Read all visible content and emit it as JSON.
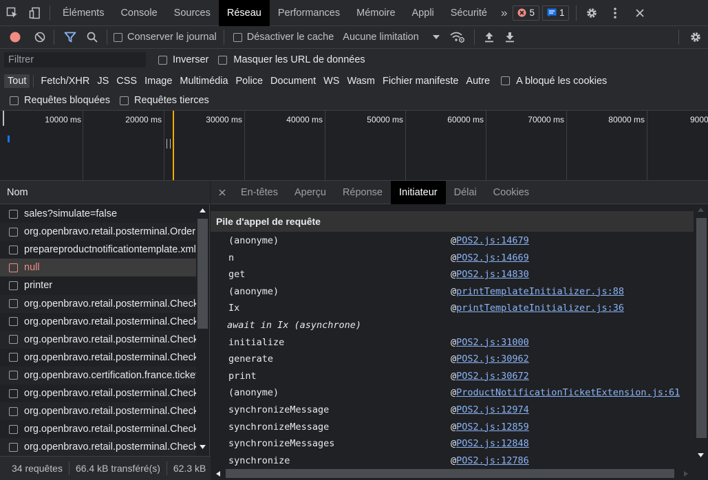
{
  "tabs": {
    "items": [
      "Éléments",
      "Console",
      "Sources",
      "Réseau",
      "Performances",
      "Mémoire",
      "Appli",
      "Sécurité"
    ],
    "more": "»",
    "errors": "5",
    "messages": "1"
  },
  "toolbar": {
    "preserve_log": "Conserver le journal",
    "disable_cache": "Désactiver le cache",
    "throttling": "Aucune limitation"
  },
  "filters": {
    "placeholder": "Filtrer",
    "invert": "Inverser",
    "hide_data_urls": "Masquer les URL de données",
    "types": [
      "Tout",
      "Fetch/XHR",
      "JS",
      "CSS",
      "Image",
      "Multimédia",
      "Police",
      "Document",
      "WS",
      "Wasm",
      "Fichier manifeste",
      "Autre"
    ],
    "blocked_cookies": "A bloqué les cookies",
    "blocked_requests": "Requêtes bloquées",
    "third_party": "Requêtes tierces"
  },
  "overview": {
    "ticks": [
      "10000 ms",
      "20000 ms",
      "30000 ms",
      "40000 ms",
      "50000 ms",
      "60000 ms",
      "70000 ms",
      "80000 ms",
      "9000"
    ]
  },
  "requests": {
    "header": "Nom",
    "items": [
      "sales?simulate=false",
      "org.openbravo.retail.posterminal.OrderLoader",
      "prepareproductnotificationtemplate.xml",
      "null",
      "printer",
      "org.openbravo.retail.posterminal.CheckBusinessPartnerCredit",
      "org.openbravo.retail.posterminal.CheckBusinessPartnerCredit",
      "org.openbravo.retail.posterminal.CheckBusinessPartnerCredit",
      "org.openbravo.retail.posterminal.CheckBusinessPartnerCredit",
      "org.openbravo.certification.france.ticket",
      "org.openbravo.retail.posterminal.CheckBusinessPartnerCredit",
      "org.openbravo.retail.posterminal.CheckBusinessPartnerCredit",
      "org.openbravo.retail.posterminal.CheckBusinessPartnerCredit",
      "org.openbravo.retail.posterminal.CheckBusinessPartnerCredit"
    ],
    "selected_index": 3
  },
  "detail": {
    "tabs": [
      "En-têtes",
      "Aperçu",
      "Réponse",
      "Initiateur",
      "Délai",
      "Cookies"
    ],
    "active_tab": "Initiateur",
    "stack_header": "Pile d'appel de requête",
    "at": "@",
    "frames": [
      {
        "fn": "(anonyme)",
        "loc": "POS2.js:14679"
      },
      {
        "fn": "n",
        "loc": "POS2.js:14669"
      },
      {
        "fn": "get",
        "loc": "POS2.js:14830"
      },
      {
        "fn": "(anonyme)",
        "loc": "printTemplateInitializer.js:88"
      },
      {
        "fn": "Ix",
        "loc": "printTemplateInitializer.js:36"
      },
      {
        "fn": "await in Ix (asynchrone)",
        "loc": ""
      },
      {
        "fn": "initialize",
        "loc": "POS2.js:31000"
      },
      {
        "fn": "generate",
        "loc": "POS2.js:30962"
      },
      {
        "fn": "print",
        "loc": "POS2.js:30672"
      },
      {
        "fn": "(anonyme)",
        "loc": "ProductNotificationTicketExtension.js:61"
      },
      {
        "fn": "synchronizeMessage",
        "loc": "POS2.js:12974"
      },
      {
        "fn": "synchronizeMessage",
        "loc": "POS2.js:12859"
      },
      {
        "fn": "synchronizeMessages",
        "loc": "POS2.js:12848"
      },
      {
        "fn": "synchronize",
        "loc": "POS2.js:12786"
      }
    ]
  },
  "status": {
    "requests": "34 requêtes",
    "transferred": "66.4 kB transféré(s)",
    "resources": "62.3 kB"
  },
  "colors": {
    "record": "#f28b82",
    "filter_active": "#8ab4f8",
    "link": "#8ab4f8",
    "error_badge": "#f28b82",
    "message_badge": "#1a73e8",
    "timeline_marker": "#f9ab00"
  }
}
